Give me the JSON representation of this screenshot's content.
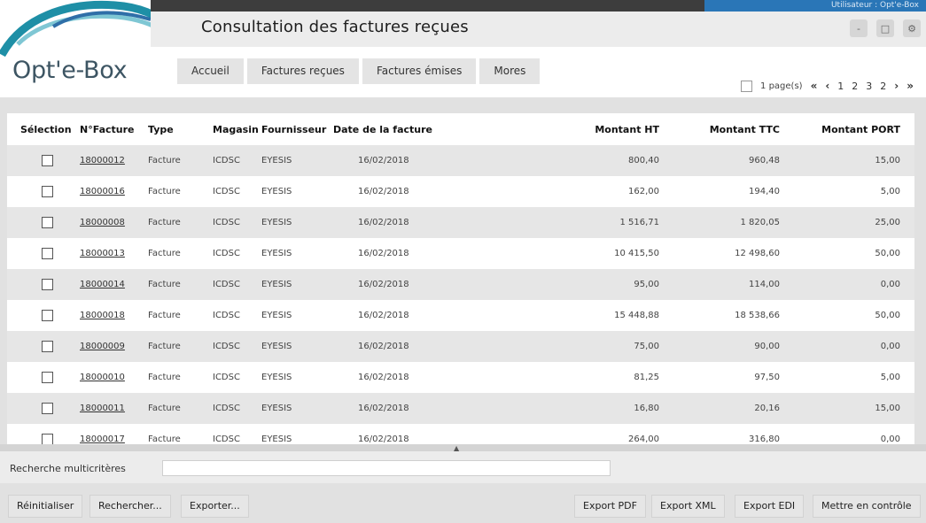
{
  "app": {
    "logo": "Opt'e-Box",
    "page_title": "Consultation des factures reçues",
    "user_info": "Utilisateur : Opt'e-Box"
  },
  "window_controls": [
    "-",
    "□",
    "⚙"
  ],
  "nav": {
    "tabs": [
      "Accueil",
      "Factures reçues",
      "Factures émises",
      "Mores"
    ]
  },
  "pager": {
    "label": "1 page(s)",
    "first": "«",
    "prev": "‹",
    "pages": [
      "1",
      "2",
      "3"
    ],
    "current": "2",
    "next": "›",
    "last": "»"
  },
  "grid": {
    "columns": [
      "Sélection",
      "N°Facture",
      "Type",
      "Magasin",
      "Fournisseur",
      "Date de la facture",
      "Montant HT",
      "Montant TTC",
      "Montant PORT"
    ],
    "rows": [
      {
        "num": "18000012",
        "type": "Facture",
        "mag": "ICDSC",
        "fourn": "EYESIS",
        "date": "16/02/2018",
        "ht": "800,40",
        "ttc": "960,48",
        "port": "15,00"
      },
      {
        "num": "18000016",
        "type": "Facture",
        "mag": "ICDSC",
        "fourn": "EYESIS",
        "date": "16/02/2018",
        "ht": "162,00",
        "ttc": "194,40",
        "port": "5,00"
      },
      {
        "num": "18000008",
        "type": "Facture",
        "mag": "ICDSC",
        "fourn": "EYESIS",
        "date": "16/02/2018",
        "ht": "1 516,71",
        "ttc": "1 820,05",
        "port": "25,00"
      },
      {
        "num": "18000013",
        "type": "Facture",
        "mag": "ICDSC",
        "fourn": "EYESIS",
        "date": "16/02/2018",
        "ht": "10 415,50",
        "ttc": "12 498,60",
        "port": "50,00"
      },
      {
        "num": "18000014",
        "type": "Facture",
        "mag": "ICDSC",
        "fourn": "EYESIS",
        "date": "16/02/2018",
        "ht": "95,00",
        "ttc": "114,00",
        "port": "0,00"
      },
      {
        "num": "18000018",
        "type": "Facture",
        "mag": "ICDSC",
        "fourn": "EYESIS",
        "date": "16/02/2018",
        "ht": "15 448,88",
        "ttc": "18 538,66",
        "port": "50,00"
      },
      {
        "num": "18000009",
        "type": "Facture",
        "mag": "ICDSC",
        "fourn": "EYESIS",
        "date": "16/02/2018",
        "ht": "75,00",
        "ttc": "90,00",
        "port": "0,00"
      },
      {
        "num": "18000010",
        "type": "Facture",
        "mag": "ICDSC",
        "fourn": "EYESIS",
        "date": "16/02/2018",
        "ht": "81,25",
        "ttc": "97,50",
        "port": "5,00"
      },
      {
        "num": "18000011",
        "type": "Facture",
        "mag": "ICDSC",
        "fourn": "EYESIS",
        "date": "16/02/2018",
        "ht": "16,80",
        "ttc": "20,16",
        "port": "15,00"
      },
      {
        "num": "18000017",
        "type": "Facture",
        "mag": "ICDSC",
        "fourn": "EYESIS",
        "date": "16/02/2018",
        "ht": "264,00",
        "ttc": "316,80",
        "port": "0,00"
      }
    ]
  },
  "search": {
    "label": "Recherche multicritères"
  },
  "actions": {
    "left": [
      "Réinitialiser",
      "Rechercher...",
      "Exporter..."
    ],
    "right": [
      "Export PDF",
      "Export XML",
      "Export EDI",
      "Mettre en contrôle"
    ]
  },
  "colors": {
    "accent_blue": "#2a76b7",
    "logo_teal": "#1e8fa6",
    "logo_text": "#3d5563"
  }
}
